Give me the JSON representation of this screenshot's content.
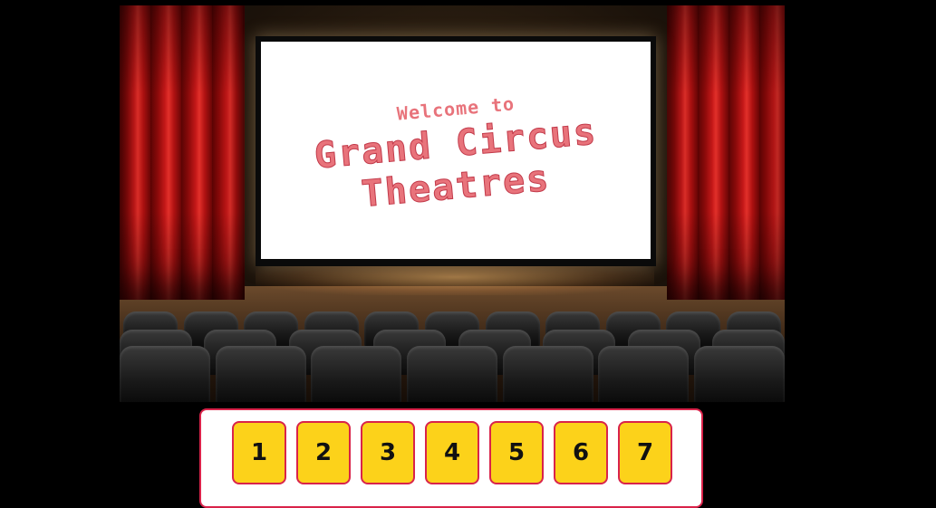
{
  "screen": {
    "welcome": "Welcome to",
    "title_line1": "Grand Circus",
    "title_line2": "Theatres"
  },
  "seat_buttons": {
    "row1": [
      "1",
      "2",
      "3",
      "4",
      "5",
      "6",
      "7"
    ]
  },
  "colors": {
    "curtain": "#c41818",
    "button_fill": "#fcd21a",
    "button_border": "#d9234a",
    "title_text": "#e8737b"
  }
}
